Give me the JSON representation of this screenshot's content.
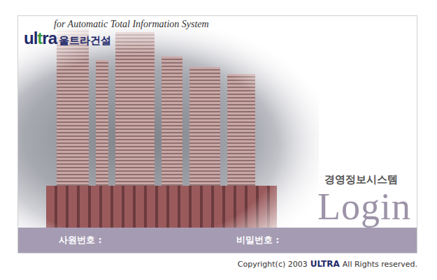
{
  "header": {
    "tagline": "for Automatic Total Information System",
    "logo": {
      "mark": [
        {
          "text": "ul",
          "color": "#1f2a6b"
        },
        {
          "text": "t",
          "color": "#3c9a3c"
        },
        {
          "text": "ra",
          "color": "#1f2a6b"
        }
      ],
      "name": "울트라건설"
    }
  },
  "system_title": "경영정보시스템",
  "login_title": "Login",
  "fields": [
    {
      "label": "사원번호 :"
    },
    {
      "label": "비밀번호 :"
    }
  ],
  "footer": {
    "prefix": "Copyright(c) 2003",
    "brand": "ULTRA",
    "suffix": "All Rights reserved."
  }
}
